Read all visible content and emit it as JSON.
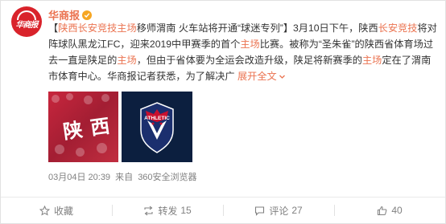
{
  "author": {
    "name": "华商报",
    "avatar_label": "华商报",
    "verified_icon": "verified-badge-icon",
    "brand_color": "#eb7350",
    "avatar_color": "#d9232b"
  },
  "post": {
    "bracket_open": "【",
    "seg1_hl": "陕西长安竞技主场",
    "seg2": "移师渭南 火车站将开通“球迷专列”",
    "bracket_close": "】",
    "seg3": "3月10日下午，陕西",
    "seg4_hl": "长安竞技",
    "seg5": "将对阵球队黑龙江FC，迎来2019中甲赛季的首个",
    "seg6_hl": "主场",
    "seg7": "比赛。被称为“圣朱雀”的陕西省体育场过去一直是陕足的",
    "seg8_hl": "主场",
    "seg9": "，但由于省体要为全运会改造升级，陕足将新赛季的",
    "seg10_hl": "主场",
    "seg11": "定在了渭南市体育中心。华商报记者获悉，为了解决广",
    "expand_label": "展开全文",
    "expand_icon": "chevron-down-icon"
  },
  "media": [
    {
      "label": "陕西",
      "desc": "fan-banner-photo"
    },
    {
      "label": "ATHLETIC",
      "desc": "club-crest-logo",
      "crest_color": "#1b2f6e",
      "accent": "#c8102e"
    }
  ],
  "meta": {
    "date": "03月04日 20:39",
    "source_prefix": "来自",
    "source": "360安全浏览器"
  },
  "actions": [
    {
      "key": "favorite",
      "label": "收藏",
      "count": ""
    },
    {
      "key": "repost",
      "label": "转发",
      "count": "15"
    },
    {
      "key": "comment",
      "label": "评论",
      "count": "27"
    },
    {
      "key": "like",
      "label": "",
      "count": "40"
    }
  ]
}
